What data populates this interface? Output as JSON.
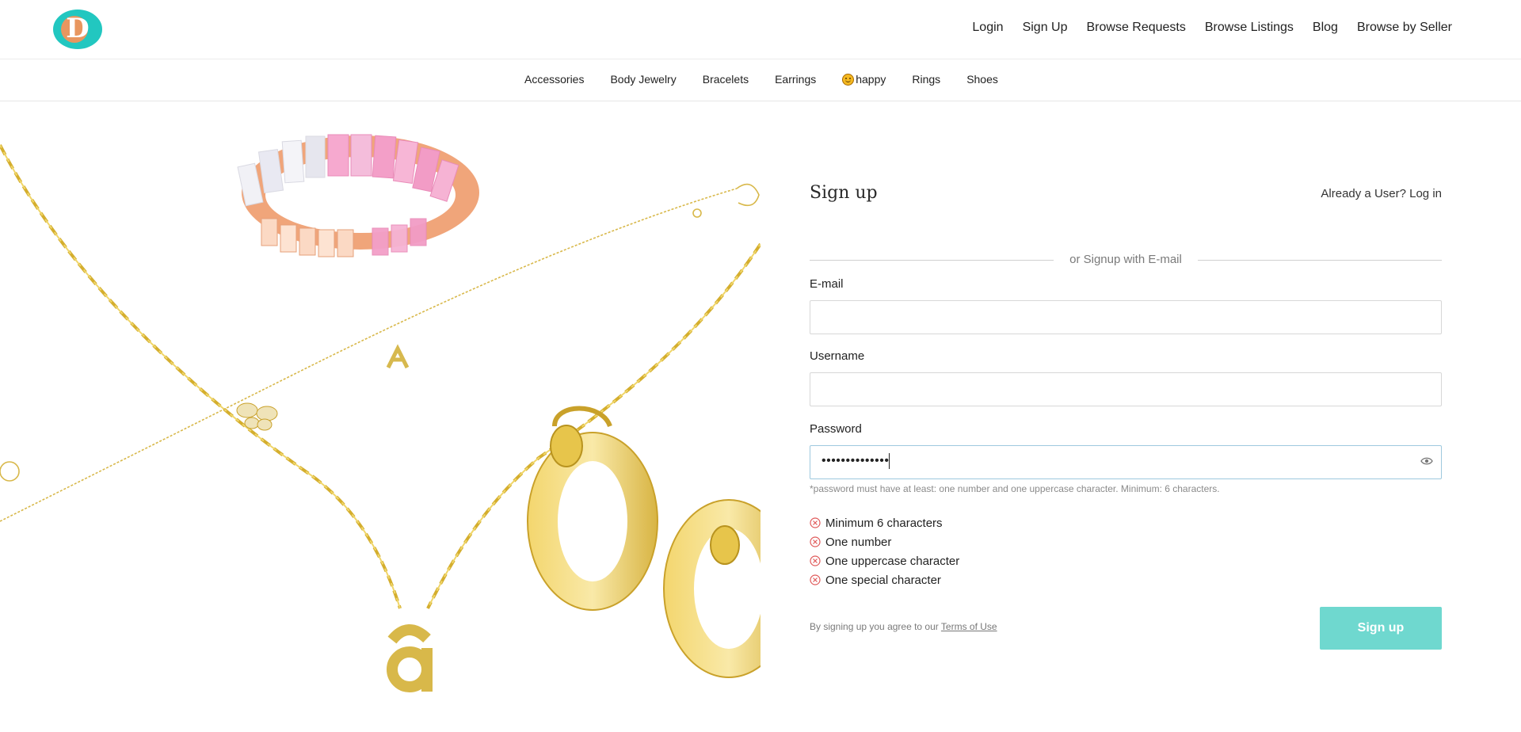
{
  "brand": {
    "logo_letter": "D",
    "logo_color": "#22c7c0",
    "logo_accent": "#e8965f"
  },
  "topnav": {
    "login": "Login",
    "signup": "Sign Up",
    "browse_requests": "Browse Requests",
    "browse_listings": "Browse Listings",
    "blog": "Blog",
    "browse_by_seller": "Browse by Seller"
  },
  "categories": {
    "accessories": "Accessories",
    "body_jewelry": "Body Jewelry",
    "bracelets": "Bracelets",
    "earrings": "Earrings",
    "happy": "happy",
    "rings": "Rings",
    "shoes": "Shoes"
  },
  "form": {
    "title": "Sign up",
    "already_user": "Already a User? Log in",
    "divider_text": "or Signup with E-mail",
    "email_label": "E-mail",
    "email_value": "",
    "username_label": "Username",
    "username_value": "",
    "password_label": "Password",
    "password_masked": "••••••••••••••",
    "password_hint": "*password must have at least: one number and one uppercase character. Minimum: 6 characters.",
    "rules": [
      {
        "label": "Minimum 6 characters",
        "status": "unmet"
      },
      {
        "label": "One number",
        "status": "unmet"
      },
      {
        "label": "One uppercase character",
        "status": "unmet"
      },
      {
        "label": "One special character",
        "status": "unmet"
      }
    ],
    "terms_prefix": "By signing up you agree to our",
    "terms_link": "Terms of Use",
    "submit_label": "Sign up",
    "submit_color": "#6fd8cf",
    "rule_icon": "x-circle-icon",
    "rule_icon_color": "#e05a5a"
  },
  "hero_image": {
    "subject": "gold jewelry: chain necklace, bracelet, pink-and-white baguette ring, hoop earrings"
  }
}
